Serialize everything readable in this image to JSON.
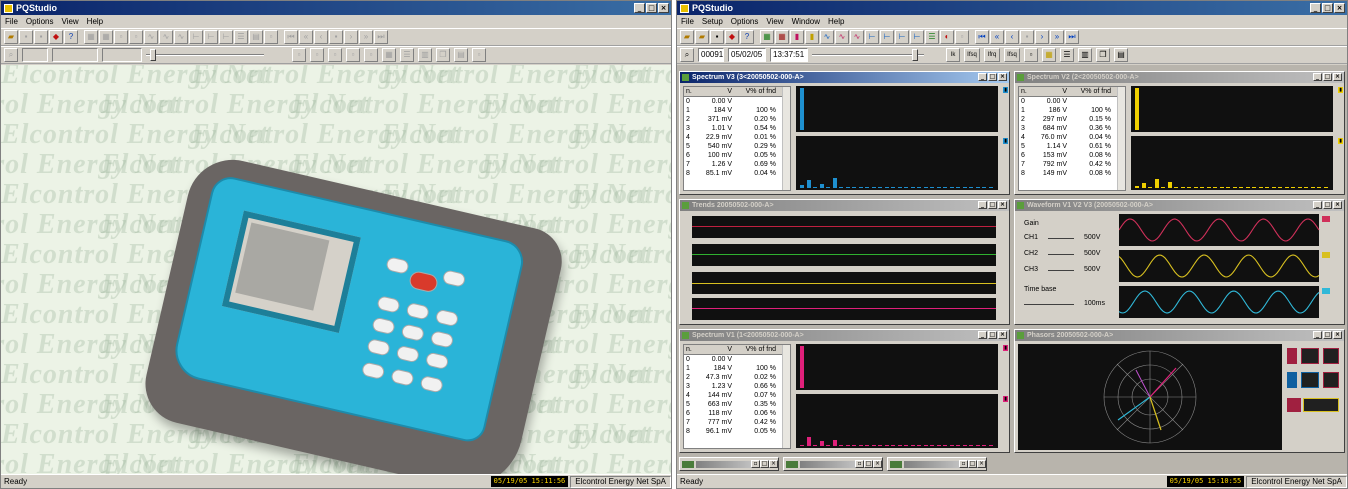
{
  "left": {
    "app_title": "PQStudio",
    "menu": [
      "File",
      "Options",
      "View",
      "Help"
    ],
    "watermark_text": "Elcontrol Energy Net",
    "status_text": "Ready",
    "status_clock": "05/19/05 15:11:56",
    "status_company": "Elcontrol Energy Net SpA"
  },
  "right": {
    "app_title": "PQStudio",
    "menu": [
      "File",
      "Setup",
      "Options",
      "View",
      "Window",
      "Help"
    ],
    "toolbar2": {
      "record_no": "00091",
      "date": "05/02/05",
      "time": "13:37:51",
      "buttons": [
        "Ik",
        "Ifsq",
        "Ifrq",
        "Ifsq"
      ]
    },
    "windows": {
      "spectrum_v3": {
        "title": "Spectrum V3 (3<20050502-000-A>",
        "headers": [
          "n.",
          "V",
          "V% of fnd"
        ],
        "rows": [
          [
            "0",
            "0.00 V",
            ""
          ],
          [
            "1",
            "184 V",
            "100 %"
          ],
          [
            "2",
            "371 mV",
            "0.20 %"
          ],
          [
            "3",
            "1.01 V",
            "0.54 %"
          ],
          [
            "4",
            "22.9 mV",
            "0.01 %"
          ],
          [
            "5",
            "540 mV",
            "0.29 %"
          ],
          [
            "6",
            "100 mV",
            "0.05 %"
          ],
          [
            "7",
            "1.26 V",
            "0.69 %"
          ],
          [
            "8",
            "85.1 mV",
            "0.04 %"
          ]
        ]
      },
      "spectrum_v2": {
        "title": "Spectrum V2 (2<20050502-000-A>",
        "headers": [
          "n.",
          "V",
          "V% of fnd"
        ],
        "rows": [
          [
            "0",
            "0.00 V",
            ""
          ],
          [
            "1",
            "186 V",
            "100 %"
          ],
          [
            "2",
            "297 mV",
            "0.15 %"
          ],
          [
            "3",
            "684 mV",
            "0.36 %"
          ],
          [
            "4",
            "76.0 mV",
            "0.04 %"
          ],
          [
            "5",
            "1.14 V",
            "0.61 %"
          ],
          [
            "6",
            "153 mV",
            "0.08 %"
          ],
          [
            "7",
            "792 mV",
            "0.42 %"
          ],
          [
            "8",
            "149 mV",
            "0.08 %"
          ]
        ]
      },
      "trends": {
        "title": "Trends 20050502-000-A>"
      },
      "waveform": {
        "title": "Waveform V1 V2 V3 (20050502-000-A>",
        "gain_label": "Gain",
        "channels": [
          {
            "name": "CH1",
            "value": "500V"
          },
          {
            "name": "CH2",
            "value": "500V"
          },
          {
            "name": "CH3",
            "value": "500V"
          }
        ],
        "timebase_label": "Time base",
        "timebase_value": "100ms"
      },
      "spectrum_v1": {
        "title": "Spectrum V1 (1<20050502-000-A>",
        "headers": [
          "n.",
          "V",
          "V% of fnd"
        ],
        "rows": [
          [
            "0",
            "0.00 V",
            ""
          ],
          [
            "1",
            "184 V",
            "100 %"
          ],
          [
            "2",
            "47.3 mV",
            "0.02 %"
          ],
          [
            "3",
            "1.23 V",
            "0.66 %"
          ],
          [
            "4",
            "144 mV",
            "0.07 %"
          ],
          [
            "5",
            "663 mV",
            "0.35 %"
          ],
          [
            "6",
            "118 mV",
            "0.06 %"
          ],
          [
            "7",
            "777 mV",
            "0.42 %"
          ],
          [
            "8",
            "96.1 mV",
            "0.05 %"
          ]
        ]
      },
      "phasors": {
        "title": "Phasors 20050502-000-A>"
      }
    },
    "status_text": "Ready",
    "status_clock": "05/19/05 15:10:55",
    "status_company": "Elcontrol Energy Net SpA",
    "colors": {
      "v3": "#1e90d0",
      "v2": "#f0d000",
      "v1": "#e0207a",
      "wave1": "#d0305a",
      "wave2": "#d8c020",
      "wave3": "#30b8d8"
    }
  }
}
